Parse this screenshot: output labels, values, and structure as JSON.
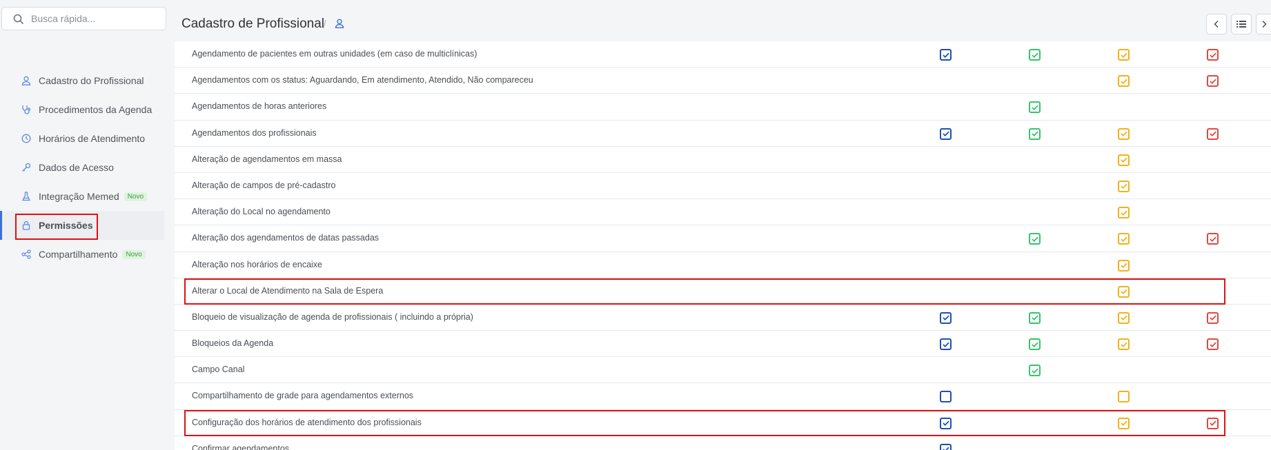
{
  "search": {
    "placeholder": "Busca rápida..."
  },
  "sidebar": {
    "items": [
      {
        "label": "Cadastro do Profissional",
        "icon": "user-icon",
        "active": false
      },
      {
        "label": "Procedimentos da Agenda",
        "icon": "stethoscope-icon",
        "active": false
      },
      {
        "label": "Horários de Atendimento",
        "icon": "clock-icon",
        "active": false
      },
      {
        "label": "Dados de Acesso",
        "icon": "key-icon",
        "active": false
      },
      {
        "label": "Integração Memed",
        "icon": "flask-icon",
        "active": false,
        "badge": "Novo"
      },
      {
        "label": "Permissões",
        "icon": "lock-icon",
        "active": true
      },
      {
        "label": "Compartilhamento",
        "icon": "share-icon",
        "active": false,
        "badge": "Novo"
      }
    ]
  },
  "header": {
    "title": "Cadastro de Profissional",
    "separator": "/"
  },
  "colors": {
    "col0": "#1e4fb3",
    "col1": "#34c46a",
    "col2": "#f0b21c",
    "col3": "#e2473d",
    "accent": "#3b6fd8",
    "highlight": "#e01010"
  },
  "permissions": [
    {
      "label": "Agendamento de pacientes em outras unidades (em caso de multiclínicas)",
      "checks": [
        1,
        1,
        1,
        1
      ]
    },
    {
      "label": "Agendamentos com os status: Aguardando, Em atendimento, Atendido, Não compareceu",
      "checks": [
        null,
        null,
        1,
        1
      ]
    },
    {
      "label": "Agendamentos de horas anteriores",
      "checks": [
        null,
        1,
        null,
        null
      ]
    },
    {
      "label": "Agendamentos dos profissionais",
      "checks": [
        1,
        1,
        1,
        1
      ]
    },
    {
      "label": "Alteração de agendamentos em massa",
      "checks": [
        null,
        null,
        1,
        null
      ]
    },
    {
      "label": "Alteração de campos de pré-cadastro",
      "checks": [
        null,
        null,
        1,
        null
      ]
    },
    {
      "label": "Alteração do Local no agendamento",
      "checks": [
        null,
        null,
        1,
        null
      ]
    },
    {
      "label": "Alteração dos agendamentos de datas passadas",
      "checks": [
        null,
        1,
        1,
        1
      ]
    },
    {
      "label": "Alteração nos horários de encaixe",
      "checks": [
        null,
        null,
        1,
        null
      ]
    },
    {
      "label": "Alterar o Local de Atendimento na Sala de Espera",
      "checks": [
        null,
        null,
        1,
        null
      ],
      "highlighted": true
    },
    {
      "label": "Bloqueio de visualização de agenda de profissionais ( incluindo a própria)",
      "checks": [
        1,
        1,
        1,
        1
      ]
    },
    {
      "label": "Bloqueios da Agenda",
      "checks": [
        1,
        1,
        1,
        1
      ]
    },
    {
      "label": "Campo Canal",
      "checks": [
        null,
        1,
        null,
        null
      ]
    },
    {
      "label": "Compartilhamento de grade para agendamentos externos",
      "checks": [
        0,
        null,
        0,
        null
      ]
    },
    {
      "label": "Configuração dos horários de atendimento dos profissionais",
      "checks": [
        1,
        null,
        1,
        1
      ],
      "highlighted": true
    },
    {
      "label": "Confirmar agendamentos",
      "checks": [
        1,
        null,
        null,
        null
      ]
    }
  ]
}
